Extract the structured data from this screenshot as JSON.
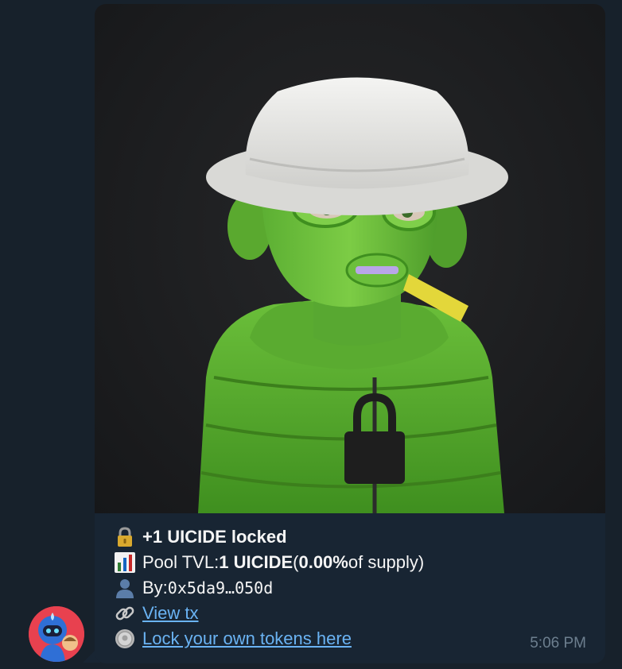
{
  "message": {
    "title_amount": "+1 UICIDE locked",
    "pool_tvl_label": "Pool TVL: ",
    "pool_tvl_value": "1 UICIDE",
    "pool_tvl_open": " (",
    "pool_tvl_percent": "0.00%",
    "pool_tvl_suffix": " of supply)",
    "by_label": "By: ",
    "by_address": "0x5da9…050d",
    "view_tx_link": "View tx",
    "lock_link": "Lock your own tokens here",
    "time": "5:06 PM"
  },
  "icons": {
    "line1": "lock-icon",
    "line2": "bar-chart-icon",
    "line3": "user-silhouette-icon",
    "line4": "link-icon",
    "line5": "coin-icon"
  },
  "colors": {
    "background": "#17212b",
    "bubble": "#182533",
    "link": "#6ab3f3",
    "text": "#f5f5f5",
    "timestamp": "#6d7f8f",
    "avatar": "#e8414f"
  }
}
